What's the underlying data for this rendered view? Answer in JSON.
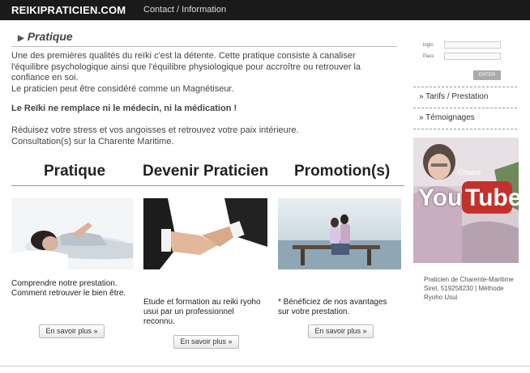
{
  "header": {
    "brand": "REIKIPRATICIEN.COM",
    "nav": "Contact / Information"
  },
  "main": {
    "section_title": "Pratique",
    "intro_lines": [
      "Une des premières qualités du reïki c'est la détente. Cette pratique consiste à canaliser",
      "l'équilibre psychologique ainsi que l'équilibre physiologique pour accroître ou retrouver la",
      "confiance en soi.",
      "Le praticien peut être considéré comme un Magnétiseur."
    ],
    "warning": "Le Reïki ne remplace ni le médecin, ni la médication !",
    "stress_lines": [
      "Réduisez votre stress et vos angoisses et retrouvez votre paix intérieure.",
      "Consultation(s) sur la Charente Maritime."
    ],
    "columns": [
      {
        "heading": "Pratique",
        "text_lines": [
          "Comprendre notre prestation.",
          "Comment retrouver le bien être."
        ],
        "button": "En savoir plus »"
      },
      {
        "heading": "Devenir Praticien",
        "text_lines": [
          "Etude et formation au reiki ryoho",
          "usui par un professionnel",
          "reconnu."
        ],
        "button": "En savoir plus »"
      },
      {
        "heading": "Promotion(s)",
        "text_lines": [
          "* Bénéficiez de nos avantages",
          "sur votre prestation."
        ],
        "button": "En savoir plus »"
      }
    ]
  },
  "sidebar": {
    "login_label": "login",
    "pass_label": "Pass",
    "login_value": "",
    "pass_value": "",
    "enter_label": "ENTER",
    "links": [
      "» Tarifs / Prestation",
      "» Témoignages"
    ],
    "video": {
      "chaine": "Chaine",
      "you": "You",
      "tube": "Tube"
    },
    "footer_lines": [
      "Praticien de Charente-Maritime",
      "Siret. 519258230 | Méthode",
      "Ryoho Usui"
    ]
  }
}
